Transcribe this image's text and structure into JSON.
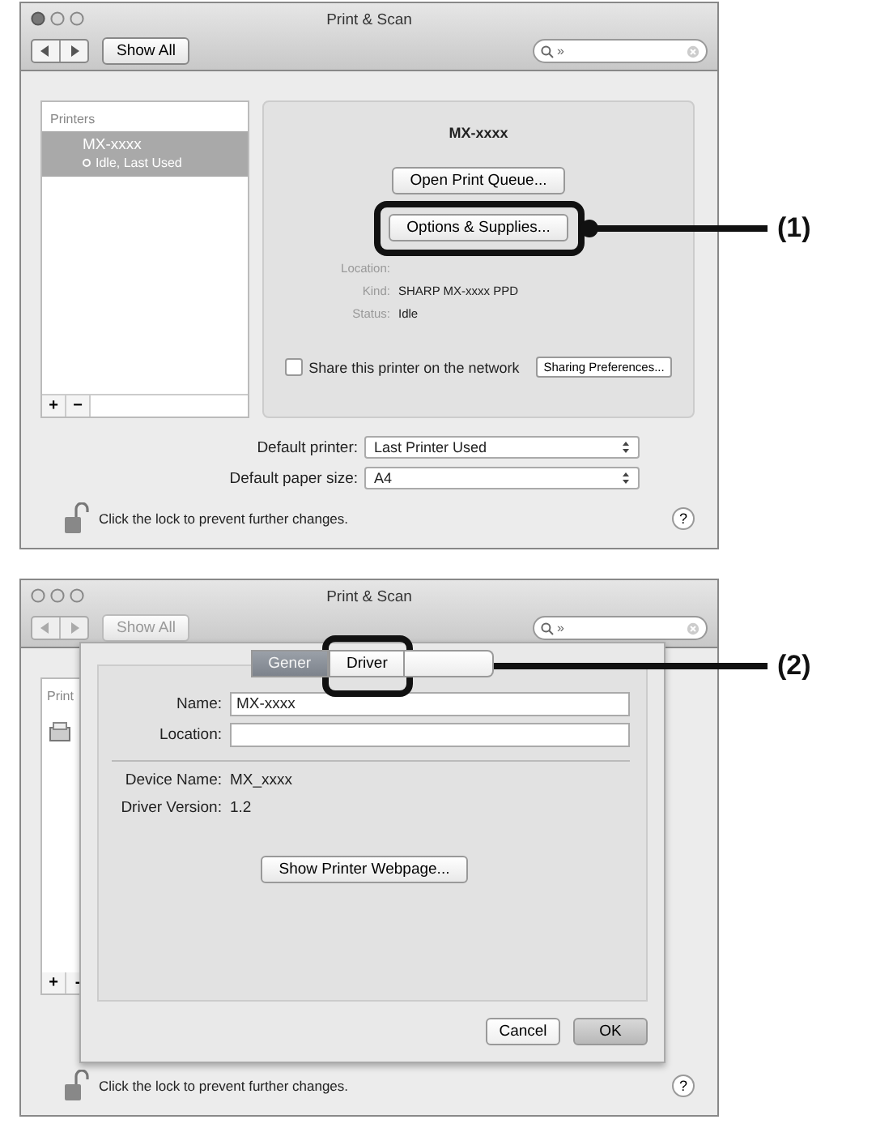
{
  "print_scan_window": {
    "title": "Print & Scan",
    "show_all": "Show All",
    "search_value": "»",
    "sidebar": {
      "header": "Printers",
      "items": [
        {
          "name": "MX-xxxx",
          "status": "Idle, Last Used",
          "selected": true
        }
      ]
    },
    "detail": {
      "printer_name": "MX-xxxx",
      "buttons": [
        "Open Print Queue...",
        "Options & Supplies..."
      ],
      "fields": [
        {
          "label": "Location:"
        },
        {
          "label": "Kind:",
          "value": "SHARP MX-xxxx PPD"
        },
        {
          "label": "Status:",
          "value": "Idle"
        }
      ],
      "share": {
        "label": "Share this printer on the network",
        "checked": false,
        "button": "Sharing Preferences..."
      }
    },
    "list_buttons": [
      "+",
      "−"
    ],
    "defaults": [
      {
        "label": "Default printer:",
        "value": "Last Printer Used"
      },
      {
        "label": "Default paper size:",
        "value": "A4"
      }
    ],
    "lock_text": "Click the lock to prevent further changes.",
    "help": "?"
  },
  "driver_sheet_window": {
    "title": "Print & Scan",
    "show_all": "Show All",
    "search_value": "»",
    "sidebar_header": "Print",
    "list_buttons": [
      "+",
      "-"
    ],
    "sheet": {
      "tabs": [
        {
          "label": "Gener",
          "selected": true
        },
        {
          "label": "Driver",
          "selected": false
        }
      ],
      "fields": [
        {
          "label": "Name:",
          "value": "MX-xxxx"
        },
        {
          "label": "Location:"
        }
      ],
      "info": [
        {
          "label": "Device Name:",
          "value": "MX_xxxx"
        },
        {
          "label": "Driver Version:",
          "value": "1.2"
        }
      ],
      "webpage_button": "Show Printer Webpage...",
      "footer_buttons": [
        {
          "label": "Cancel",
          "default": false
        },
        {
          "label": "OK",
          "default": true
        }
      ]
    },
    "lock_text": "Click the lock to prevent further changes.",
    "help": "?"
  },
  "callouts": [
    {
      "label": "(1)"
    },
    {
      "label": "(2)"
    }
  ]
}
